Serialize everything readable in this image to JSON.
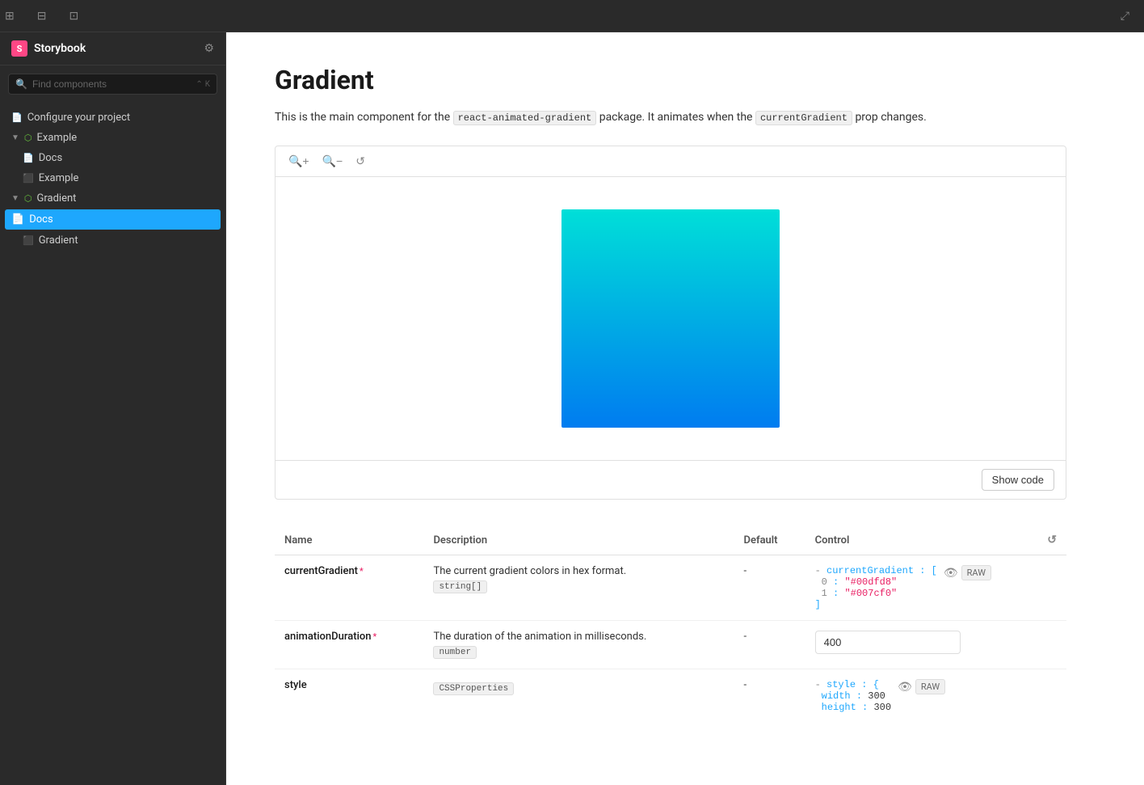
{
  "topbar": {
    "icons": [
      "grid-2x2",
      "grid-3x3",
      "layout"
    ],
    "resize_icon": "⤢"
  },
  "sidebar": {
    "logo_text": "S",
    "title": "Storybook",
    "search_placeholder": "Find components",
    "search_shortcut": [
      "⌃",
      "K"
    ],
    "gear_icon": "⚙",
    "nav": [
      {
        "id": "configure",
        "label": "Configure your project",
        "type": "doc",
        "indent": 0
      },
      {
        "id": "example-group",
        "label": "Example",
        "type": "group",
        "indent": 0,
        "expanded": true
      },
      {
        "id": "example-docs",
        "label": "Docs",
        "type": "doc",
        "indent": 1
      },
      {
        "id": "example-story",
        "label": "Example",
        "type": "story",
        "indent": 1
      },
      {
        "id": "gradient-group",
        "label": "Gradient",
        "type": "group",
        "indent": 0,
        "expanded": true
      },
      {
        "id": "gradient-docs",
        "label": "Docs",
        "type": "doc",
        "indent": 1,
        "active": true
      },
      {
        "id": "gradient-story",
        "label": "Gradient",
        "type": "story",
        "indent": 1
      }
    ]
  },
  "content": {
    "title": "Gradient",
    "description_parts": [
      {
        "text": "This is the main component for the ",
        "type": "normal"
      },
      {
        "text": "react-animated-gradient",
        "type": "code"
      },
      {
        "text": " package. It animates when the ",
        "type": "normal"
      },
      {
        "text": "currentGradient",
        "type": "code"
      },
      {
        "text": " prop changes.",
        "type": "normal"
      }
    ],
    "gradient_colors": [
      "#00dfd8",
      "#007cf0"
    ],
    "show_code_label": "Show code",
    "table": {
      "headers": [
        "Name",
        "Description",
        "Default",
        "Control"
      ],
      "rows": [
        {
          "name": "currentGradient",
          "required": true,
          "description": "The current gradient colors in hex format.",
          "type_tag": "string[]",
          "default": "-",
          "control_type": "array",
          "control_value": {
            "label": "currentGradient",
            "items": [
              {
                "index": 0,
                "value": "\"#00dfd8\""
              },
              {
                "index": 1,
                "value": "\"#007cf0\""
              }
            ]
          },
          "has_raw": true
        },
        {
          "name": "animationDuration",
          "required": true,
          "description": "The duration of the animation in milliseconds.",
          "type_tag": "number",
          "default": "-",
          "control_type": "number",
          "control_value": "400",
          "has_raw": false
        },
        {
          "name": "style",
          "required": false,
          "description": "",
          "type_tag": "CSSProperties",
          "default": "-",
          "control_type": "object",
          "control_value": {
            "label": "style",
            "items": [
              {
                "key": "width",
                "value": "300"
              },
              {
                "key": "height",
                "value": "300"
              }
            ]
          },
          "has_raw": true
        }
      ]
    }
  }
}
